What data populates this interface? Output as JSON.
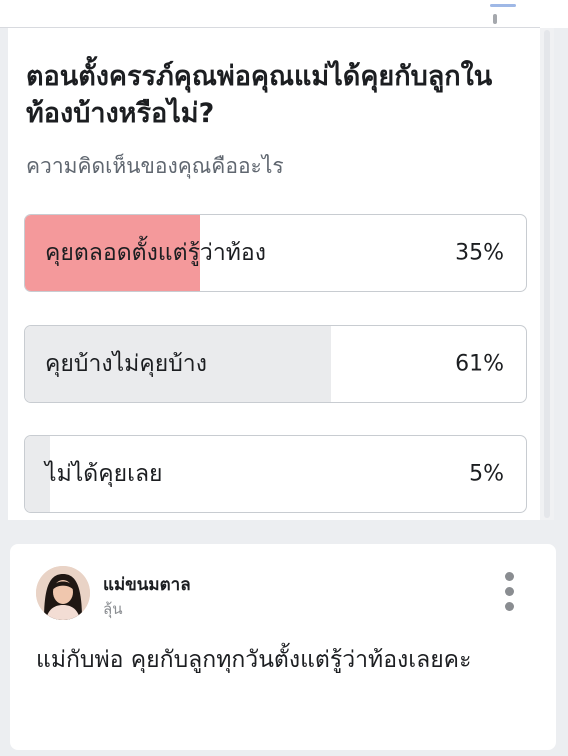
{
  "poll": {
    "question": "ตอนตั้งครรภ์คุณพ่อคุณแม่ได้คุยกับลูกในท้องบ้างหรือไม่?",
    "subtitle": "ความคิดเห็นของคุณคืออะไร",
    "options": [
      {
        "label": "คุยตลอดตั้งแต่รู้ว่าท้อง",
        "percent_text": "35%",
        "fraction": 0.35,
        "fill_color": "#f4999b",
        "selected": true
      },
      {
        "label": "คุยบ้างไม่คุยบ้าง",
        "percent_text": "61%",
        "fraction": 0.61,
        "fill_color": "#eaebed",
        "selected": false
      },
      {
        "label": "ไม่ได้คุยเลย",
        "percent_text": "5%",
        "fraction": 0.05,
        "fill_color": "#eaebed",
        "selected": false
      }
    ]
  },
  "comment": {
    "user": "แม่ขนมตาล",
    "sublabel": "ลุ้น",
    "text": "แม่กับพ่อ คุยกับลูกทุกวันตั้งแต่รู้ว่าท้องเลยคะ",
    "avatar_icon": "user-avatar",
    "menu_icon": "more-vertical-icon"
  },
  "colors": {
    "selected_fill": "#f4999b",
    "unselected_fill": "#eaebed",
    "border": "#c8ccd1",
    "card_bg": "#ffffff",
    "page_bg": "#eceef1"
  }
}
